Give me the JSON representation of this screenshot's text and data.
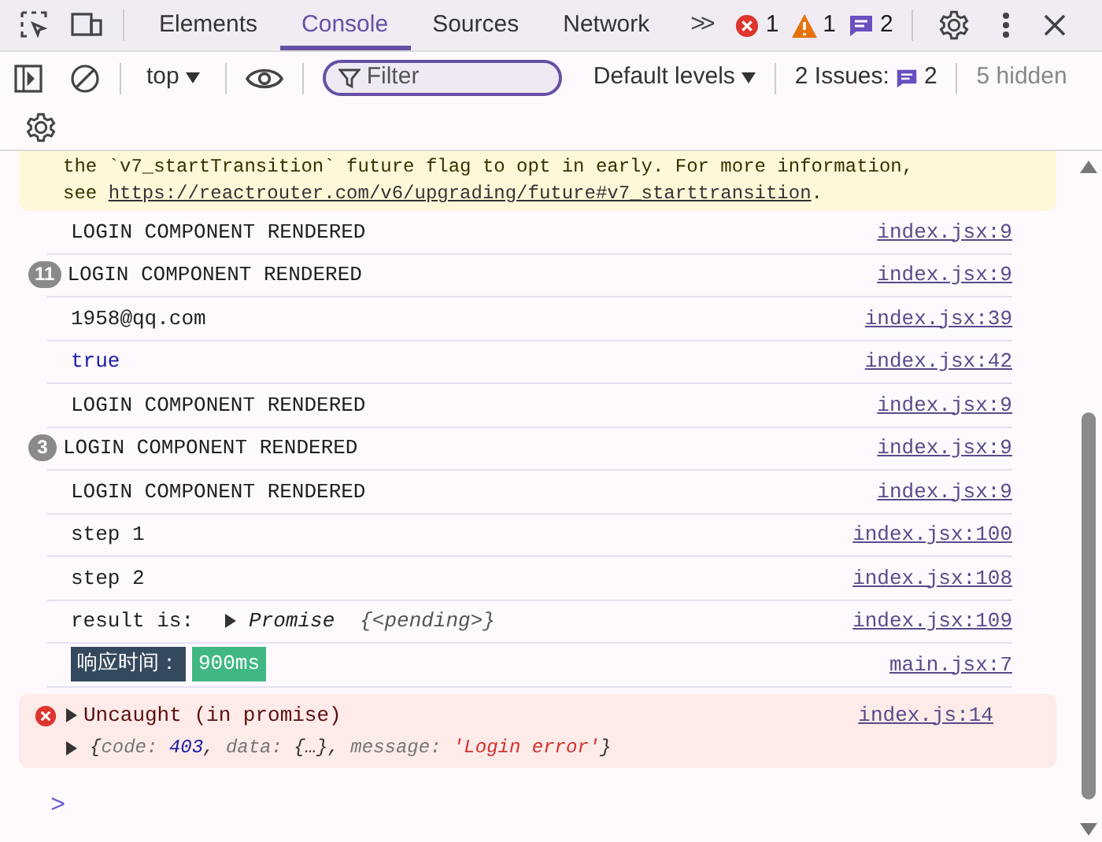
{
  "tabs": [
    {
      "label": "Elements",
      "selected": false
    },
    {
      "label": "Console",
      "selected": true
    },
    {
      "label": "Sources",
      "selected": false
    },
    {
      "label": "Network",
      "selected": false
    }
  ],
  "more_tabs": ">>",
  "counters": {
    "errors": "1",
    "warnings": "1",
    "messages": "2"
  },
  "toolbar": {
    "context": "top",
    "filter": {
      "placeholder": "Filter"
    },
    "levels": "Default levels",
    "issues_label": "2 Issues:",
    "issues_count": "2",
    "hidden": "5 hidden"
  },
  "warning": {
    "line_1": "the `v7_startTransition` future flag to opt in early. For more information,",
    "prefix": "see ",
    "link": "https://reactrouter.com/v6/upgrading/future#v7_starttransition",
    "suffix": "."
  },
  "messages": [
    {
      "kind": "log",
      "text": "LOGIN COMPONENT RENDERED",
      "source": "index.jsx:9"
    },
    {
      "kind": "log",
      "count": "11",
      "text": "LOGIN COMPONENT RENDERED",
      "source": "index.jsx:9"
    },
    {
      "kind": "log",
      "text": "1958@qq.com",
      "source": "index.jsx:39"
    },
    {
      "kind": "boolean",
      "text": "true",
      "source": "index.jsx:42"
    },
    {
      "kind": "log",
      "text": "LOGIN COMPONENT RENDERED",
      "source": "index.jsx:9"
    },
    {
      "kind": "log",
      "count": "3",
      "text": "LOGIN COMPONENT RENDERED",
      "source": "index.jsx:9"
    },
    {
      "kind": "log",
      "text": "LOGIN COMPONENT RENDERED",
      "source": "index.jsx:9"
    },
    {
      "kind": "log",
      "text": "step 1",
      "source": "index.jsx:100"
    },
    {
      "kind": "log",
      "text": "step 2",
      "source": "index.jsx:108"
    },
    {
      "kind": "promise",
      "text": "result is:",
      "object": "Promise",
      "state": "{<pending>}",
      "source": "index.jsx:109"
    },
    {
      "kind": "styled",
      "segments": [
        {
          "text": "响应时间：",
          "color": "#35495e"
        },
        {
          "text": "900ms",
          "color": "#41b883"
        }
      ],
      "source": "main.jsx:7"
    }
  ],
  "error": {
    "title": "Uncaught (in promise)",
    "source": "index.js:14",
    "object": [
      {
        "kind": "punct",
        "text": "{"
      },
      {
        "kind": "key",
        "text": "code: "
      },
      {
        "kind": "number",
        "text": "403"
      },
      {
        "kind": "punct",
        "text": ", "
      },
      {
        "kind": "key",
        "text": "data: "
      },
      {
        "kind": "punct",
        "text": "{…}, "
      },
      {
        "kind": "key",
        "text": "message: "
      },
      {
        "kind": "string",
        "text": "'Login error'"
      },
      {
        "kind": "punct",
        "text": "}"
      }
    ]
  },
  "prompt": ">"
}
